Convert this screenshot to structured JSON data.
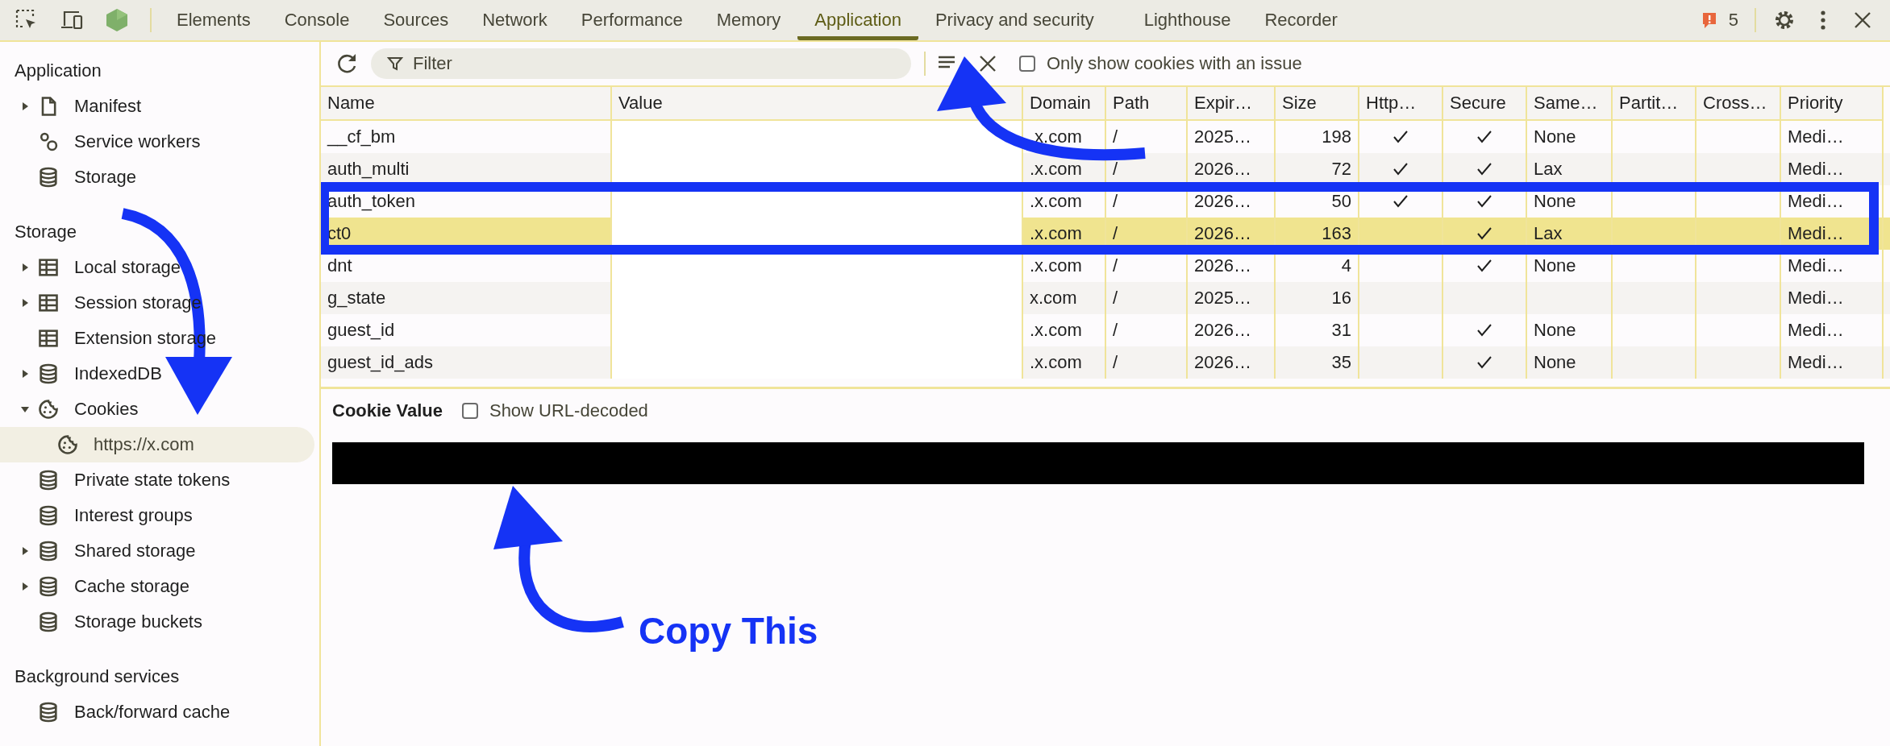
{
  "toolbar": {
    "tabs": [
      {
        "label": "Elements",
        "selected": false
      },
      {
        "label": "Console",
        "selected": false
      },
      {
        "label": "Sources",
        "selected": false
      },
      {
        "label": "Network",
        "selected": false
      },
      {
        "label": "Performance",
        "selected": false
      },
      {
        "label": "Memory",
        "selected": false
      },
      {
        "label": "Application",
        "selected": true
      },
      {
        "label": "Privacy and security",
        "selected": false
      },
      {
        "label": "Lighthouse",
        "selected": false
      },
      {
        "label": "Recorder",
        "selected": false
      }
    ],
    "issues_count": "5"
  },
  "sidebar": {
    "sections": [
      {
        "title": "Application",
        "items": [
          {
            "label": "Manifest",
            "kind": "file",
            "expanded": false,
            "selected": false
          },
          {
            "label": "Service workers",
            "kind": "gears",
            "selected": false
          },
          {
            "label": "Storage",
            "kind": "database",
            "selected": false
          }
        ]
      },
      {
        "title": "Storage",
        "items": [
          {
            "label": "Local storage",
            "kind": "table",
            "expanded": false,
            "selected": false
          },
          {
            "label": "Session storage",
            "kind": "table",
            "expanded": false,
            "selected": false
          },
          {
            "label": "Extension storage",
            "kind": "table",
            "selected": false
          },
          {
            "label": "IndexedDB",
            "kind": "database",
            "expanded": false,
            "selected": false
          },
          {
            "label": "Cookies",
            "kind": "cookie",
            "expanded": true,
            "selected": false,
            "children": [
              {
                "label": "https://x.com",
                "kind": "cookie",
                "selected": true
              }
            ]
          },
          {
            "label": "Private state tokens",
            "kind": "database",
            "selected": false
          },
          {
            "label": "Interest groups",
            "kind": "database",
            "selected": false
          },
          {
            "label": "Shared storage",
            "kind": "database",
            "expanded": false,
            "selected": false
          },
          {
            "label": "Cache storage",
            "kind": "database",
            "expanded": false,
            "selected": false
          },
          {
            "label": "Storage buckets",
            "kind": "database",
            "selected": false
          }
        ]
      },
      {
        "title": "Background services",
        "items": [
          {
            "label": "Back/forward cache",
            "kind": "database",
            "selected": false
          }
        ]
      }
    ]
  },
  "filter": {
    "placeholder": "Filter",
    "only_issues_label": "Only show cookies with an issue",
    "only_issues_checked": false
  },
  "table": {
    "columns": [
      {
        "label": "Name",
        "kind": "text"
      },
      {
        "label": "Value",
        "kind": "redacted"
      },
      {
        "label": "Domain",
        "kind": "text"
      },
      {
        "label": "Path",
        "kind": "text"
      },
      {
        "label": "Expir…",
        "kind": "text"
      },
      {
        "label": "Size",
        "kind": "number"
      },
      {
        "label": "Http…",
        "kind": "check"
      },
      {
        "label": "Secure",
        "kind": "check"
      },
      {
        "label": "Same…",
        "kind": "text"
      },
      {
        "label": "Partit…",
        "kind": "text"
      },
      {
        "label": "Cross…",
        "kind": "text"
      },
      {
        "label": "Priority",
        "kind": "text"
      }
    ],
    "rows": [
      {
        "cells": [
          "__cf_bm",
          null,
          ".x.com",
          "/",
          "2025…",
          "198",
          true,
          true,
          "None",
          null,
          null,
          "Medi…"
        ],
        "selected": false
      },
      {
        "cells": [
          "auth_multi",
          null,
          ".x.com",
          "/",
          "2026…",
          "72",
          true,
          true,
          "Lax",
          null,
          null,
          "Medi…"
        ],
        "selected": false
      },
      {
        "cells": [
          "auth_token",
          null,
          ".x.com",
          "/",
          "2026…",
          "50",
          true,
          true,
          "None",
          null,
          null,
          "Medi…"
        ],
        "selected": false
      },
      {
        "cells": [
          "ct0",
          null,
          ".x.com",
          "/",
          "2026…",
          "163",
          false,
          true,
          "Lax",
          null,
          null,
          "Medi…"
        ],
        "selected": true
      },
      {
        "cells": [
          "dnt",
          null,
          ".x.com",
          "/",
          "2026…",
          "4",
          false,
          true,
          "None",
          null,
          null,
          "Medi…"
        ],
        "selected": false
      },
      {
        "cells": [
          "g_state",
          null,
          "x.com",
          "/",
          "2025…",
          "16",
          false,
          false,
          null,
          null,
          null,
          "Medi…"
        ],
        "selected": false
      },
      {
        "cells": [
          "guest_id",
          null,
          ".x.com",
          "/",
          "2026…",
          "31",
          false,
          true,
          "None",
          null,
          null,
          "Medi…"
        ],
        "selected": false
      },
      {
        "cells": [
          "guest_id_ads",
          null,
          ".x.com",
          "/",
          "2026…",
          "35",
          false,
          true,
          "None",
          null,
          null,
          "Medi…"
        ],
        "selected": false
      }
    ]
  },
  "cookie_value": {
    "title": "Cookie Value",
    "decode_label": "Show URL-decoded",
    "decode_checked": false
  },
  "annotation": {
    "caption": "Copy This"
  }
}
